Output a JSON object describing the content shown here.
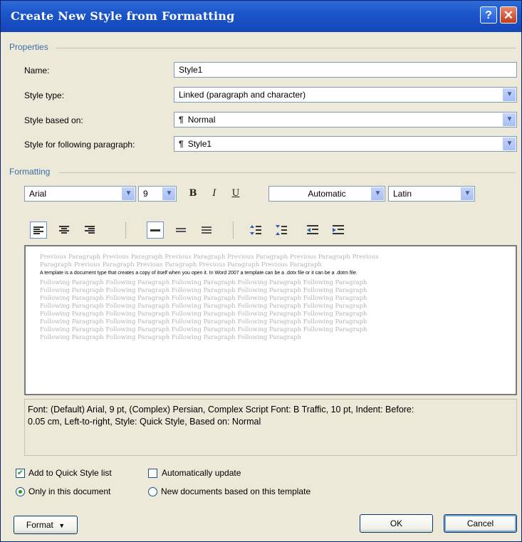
{
  "window": {
    "title": "Create New Style from Formatting",
    "help_label": "?",
    "close_label": "✕"
  },
  "properties": {
    "group_label": "Properties",
    "name_label": "Name:",
    "name_value": "Style1",
    "style_type_label": "Style type:",
    "style_type_value": "Linked (paragraph and character)",
    "based_on_label": "Style based on:",
    "based_on_value": "Normal",
    "following_label": "Style for following paragraph:",
    "following_value": "Style1"
  },
  "formatting": {
    "group_label": "Formatting",
    "font": "Arial",
    "size": "9",
    "bold": "B",
    "italic": "I",
    "underline": "U",
    "color": "Automatic",
    "script": "Latin"
  },
  "preview": {
    "previous_lines": [
      "Previous Paragraph Previous Paragraph Previous Paragraph Previous Paragraph Previous Paragraph Previous",
      "Paragraph Previous Paragraph Previous Paragraph Previous Paragraph Previous Paragraph"
    ],
    "sample_text": "A template is a document type that creates a copy of itself when you open it. In Word 2007 a template can be a .dotx file or it can be a .dotm file.",
    "following_lines": [
      "Following Paragraph Following Paragraph Following Paragraph Following Paragraph Following Paragraph",
      "Following Paragraph Following Paragraph Following Paragraph Following Paragraph Following Paragraph",
      "Following Paragraph Following Paragraph Following Paragraph Following Paragraph Following Paragraph",
      "Following Paragraph Following Paragraph Following Paragraph Following Paragraph Following Paragraph",
      "Following Paragraph Following Paragraph Following Paragraph Following Paragraph Following Paragraph",
      "Following Paragraph Following Paragraph Following Paragraph Following Paragraph Following Paragraph",
      "Following Paragraph Following Paragraph Following Paragraph Following Paragraph Following Paragraph",
      "Following Paragraph Following Paragraph Following Paragraph Following Paragraph"
    ]
  },
  "description": {
    "line1": "Font: (Default) Arial, 9 pt, (Complex) Persian, Complex Script Font: B Traffic, 10 pt, Indent: Before:",
    "line2": "0.05 cm, Left-to-right, Style: Quick Style, Based on: Normal"
  },
  "options": {
    "add_quick_style": "Add to Quick Style list",
    "add_quick_style_checked": true,
    "auto_update": "Automatically update",
    "auto_update_checked": false,
    "only_this_doc": "Only in this document",
    "new_docs": "New documents based on this template",
    "selected_scope": "only_this_doc"
  },
  "buttons": {
    "format": "Format",
    "ok": "OK",
    "cancel": "Cancel"
  },
  "colors": {
    "titlebar": "#1b56c9",
    "dialog_bg": "#ece9d8",
    "group_label": "#3a6ea5",
    "check_mark": "#21a121"
  }
}
